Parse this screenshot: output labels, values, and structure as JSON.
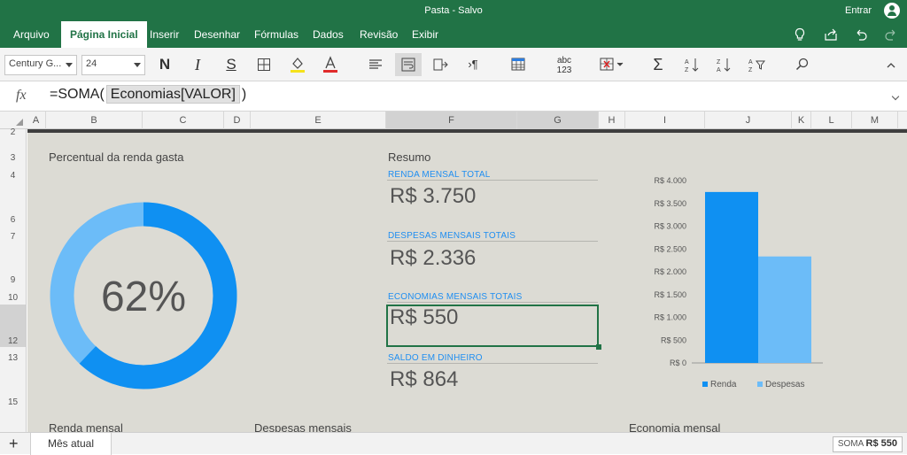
{
  "app": {
    "title": "Pasta - Salvo",
    "signin": "Entrar"
  },
  "menu": {
    "tabs": [
      "Arquivo",
      "Página Inicial",
      "Inserir",
      "Desenhar",
      "Fórmulas",
      "Dados",
      "Revisão",
      "Exibir"
    ],
    "active_tab": "Página Inicial",
    "icons": [
      "lightbulb-icon",
      "share-icon",
      "undo-icon",
      "redo-icon"
    ]
  },
  "ribbon": {
    "font_name": "Century G...",
    "font_size": "24",
    "bold": "N",
    "italic": "I",
    "underline": "S",
    "number_format": "abc 123",
    "sum": "Σ"
  },
  "formula_bar": {
    "fx": "fx",
    "prefix": "=SOMA(",
    "reference": "Economias[VALOR]",
    "suffix": ")"
  },
  "columns": [
    "A",
    "B",
    "C",
    "D",
    "E",
    "F",
    "G",
    "H",
    "I",
    "J",
    "K",
    "L",
    "M"
  ],
  "selected_column": "F",
  "rows": [
    "2",
    "3",
    "4",
    "6",
    "7",
    "9",
    "10",
    "12",
    "13",
    "15"
  ],
  "selected_row": "12",
  "dashboard": {
    "donut_title": "Percentual da renda gasta",
    "donut_percent": "62%",
    "donut_fraction": 0.62,
    "summary_title": "Resumo",
    "kpis": [
      {
        "label": "RENDA MENSAL TOTAL",
        "value": "R$ 3.750"
      },
      {
        "label": "DESPESAS MENSAIS TOTAIS",
        "value": "R$ 2.336"
      },
      {
        "label": "ECONOMIAS MENSAIS TOTAIS",
        "value": "R$ 550"
      },
      {
        "label": "SALDO EM DINHEIRO",
        "value": "R$ 864"
      }
    ],
    "bottom_labels": [
      "Renda mensal",
      "Despesas mensais",
      "Economia mensal"
    ],
    "colors": {
      "primary": "#0f90f2",
      "secondary": "#6cbcf8",
      "excel_green": "#217346"
    }
  },
  "chart_data": {
    "type": "bar",
    "categories": [
      "Renda",
      "Despesas"
    ],
    "values": [
      3750,
      2336
    ],
    "ylim": [
      0,
      4000
    ],
    "yticks": [
      "R$ 4.000",
      "R$ 3.500",
      "R$ 3.000",
      "R$ 2.500",
      "R$ 2.000",
      "R$ 1.500",
      "R$ 1.000",
      "R$ 500",
      "R$ 0"
    ],
    "legend": [
      "Renda",
      "Despesas"
    ],
    "legend_position": "bottom",
    "colors": [
      "#0f90f2",
      "#6cbcf8"
    ]
  },
  "sheet_tab": "Mês atual",
  "status": {
    "label": "SOMA",
    "value": "R$ 550"
  }
}
